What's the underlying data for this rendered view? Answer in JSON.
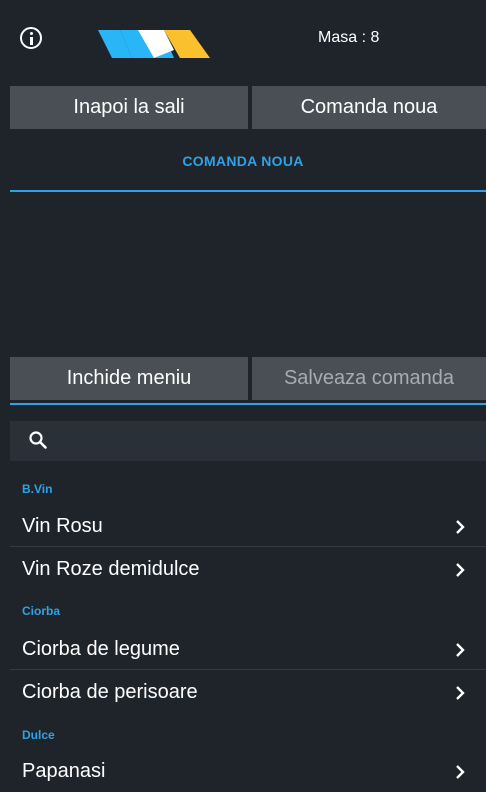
{
  "header": {
    "masa_text": "Masa : 8",
    "logo_colors": [
      "#29b6f6",
      "#ffffff",
      "#fbc02d"
    ]
  },
  "actions": {
    "back_label": "Inapoi la sali",
    "new_order_label": "Comanda noua"
  },
  "section_title": "COMANDA NOUA",
  "bottom_actions": {
    "close_menu_label": "Inchide meniu",
    "save_order_label": "Salveaza comanda"
  },
  "search": {
    "icon": "search-icon",
    "placeholder": ""
  },
  "menu": {
    "categories": [
      {
        "name": "B.Vin",
        "items": [
          "Vin Rosu",
          "Vin Roze demidulce"
        ]
      },
      {
        "name": "Ciorba",
        "items": [
          "Ciorba de legume",
          "Ciorba de perisoare"
        ]
      },
      {
        "name": "Dulce",
        "items": [
          "Papanasi"
        ]
      }
    ]
  },
  "colors": {
    "background": "#1f242b",
    "accent": "#2fa2e7",
    "button_bg": "#4a4f56"
  }
}
